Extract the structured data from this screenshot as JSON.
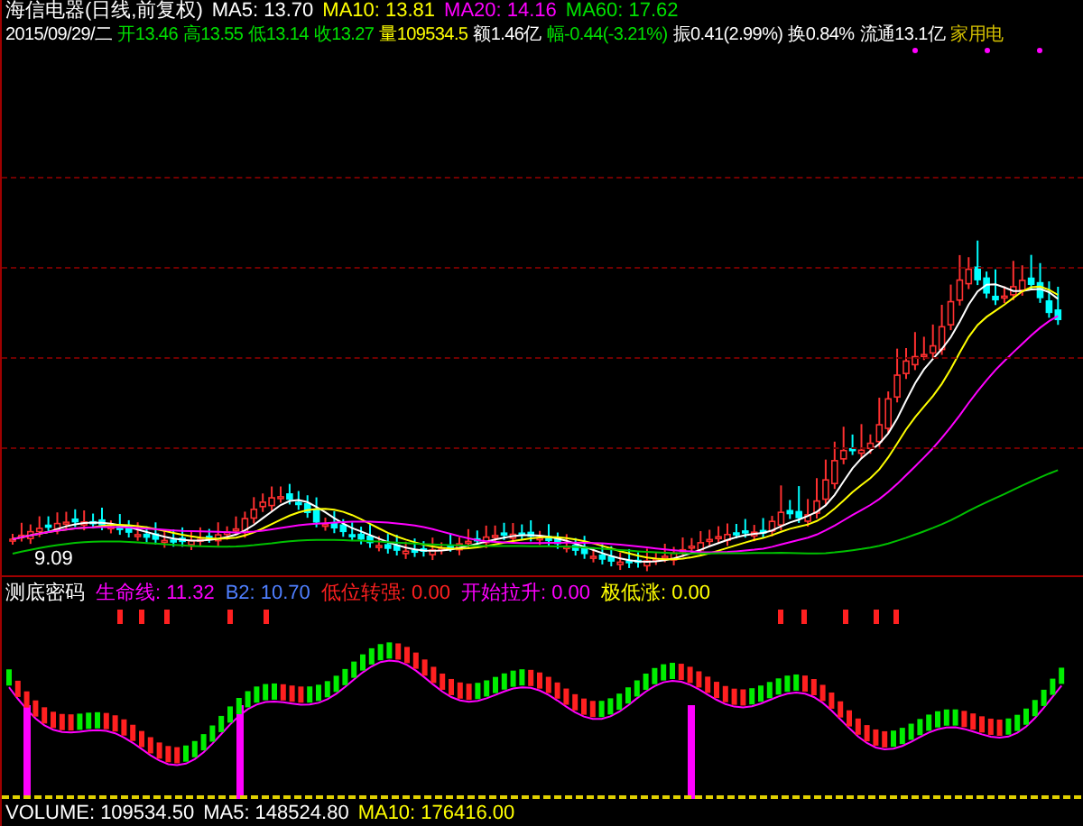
{
  "header": {
    "line_1": [
      {
        "text": "海信电器(日线,前复权)",
        "color": "#ffffff"
      },
      {
        "text": "MA5: 13.70",
        "color": "#ffffff"
      },
      {
        "text": "MA10: 13.81",
        "color": "#ffff00"
      },
      {
        "text": "MA20: 14.16",
        "color": "#ff00ff"
      },
      {
        "text": "MA60: 17.62",
        "color": "#00e000"
      }
    ],
    "line_2": [
      {
        "text": "2015/09/29/二",
        "color": "#ffffff"
      },
      {
        "text": "开13.46",
        "color": "#00e000"
      },
      {
        "text": "高13.55",
        "color": "#00e000"
      },
      {
        "text": "低13.14",
        "color": "#00e000"
      },
      {
        "text": "收13.27",
        "color": "#00e000"
      },
      {
        "text": "量109534.5",
        "color": "#ffff00"
      },
      {
        "text": "额1.46亿",
        "color": "#ffffff"
      },
      {
        "text": "幅-0.44(-3.21%)",
        "color": "#00e000"
      },
      {
        "text": "振0.41(2.99%)",
        "color": "#ffffff"
      },
      {
        "text": "换0.84%",
        "color": "#ffffff"
      },
      {
        "text": "流通13.1亿",
        "color": "#ffffff"
      },
      {
        "text": "家用电",
        "color": "#d4c000"
      }
    ]
  },
  "price_chart": {
    "low_label": "9.09"
  },
  "indicator": {
    "items": [
      {
        "text": "测底密码",
        "color": "#ffffff"
      },
      {
        "text": "生命线: 11.32",
        "color": "#ff00ff"
      },
      {
        "text": "B2: 10.70",
        "color": "#4f7fff"
      },
      {
        "text": "低位转强: 0.00",
        "color": "#ff2020"
      },
      {
        "text": "开始拉升: 0.00",
        "color": "#ff00ff"
      },
      {
        "text": "极低涨: 0.00",
        "color": "#ffff00"
      }
    ]
  },
  "volume": {
    "items": [
      {
        "text": "VOLUME: 109534.50",
        "color": "#ffffff"
      },
      {
        "text": "MA5: 148524.80",
        "color": "#ffffff"
      },
      {
        "text": "MA10: 176416.00",
        "color": "#ffff00"
      }
    ]
  }
}
